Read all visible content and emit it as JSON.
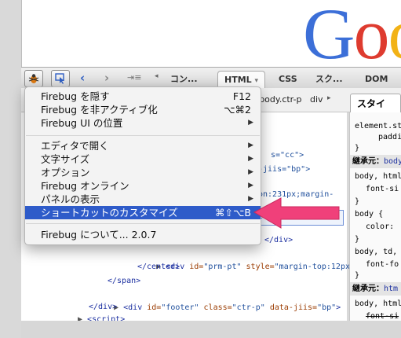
{
  "page": {
    "logo_text": "Goo"
  },
  "toolbar": {
    "tabs": [
      "コン...",
      "HTML",
      "CSS",
      "スク...",
      "DOM"
    ],
    "active_tab_arrow": "▾"
  },
  "pathbar": {
    "crumb1": "n#body.ctr-p",
    "crumb2": "div"
  },
  "side": {
    "tab_label": "スタイル",
    "rules": [
      "element.sty",
      "padding",
      "}",
      "継承元：",
      "body",
      "body, html",
      "font-si",
      "}",
      "body {",
      "color:",
      "}",
      "body, td, a",
      "font-fo",
      "}",
      "継承元：",
      "htm",
      "body, html",
      "font-si"
    ]
  },
  "menu": {
    "items": [
      {
        "label": "Firebug を隠す",
        "shortcut": "F12"
      },
      {
        "label": "Firebug を非アクティブ化",
        "shortcut": "⌥⌘2"
      },
      {
        "label": "Firebug UI の位置",
        "arrow": "▶"
      },
      {
        "label": "エディタで開く",
        "arrow": "▶"
      },
      {
        "label": "文字サイズ",
        "arrow": "▶"
      },
      {
        "label": "オプション",
        "arrow": "▶"
      },
      {
        "label": "Firebug オンライン",
        "arrow": "▶"
      },
      {
        "label": "パネルの表示",
        "arrow": "▶"
      },
      {
        "label": "ショートカットのカスタマイズ",
        "shortcut": "⌘⇧⌥B"
      },
      {
        "label": "Firebug について... 2.0.7"
      }
    ]
  },
  "code": {
    "frag1": "s=\"cc\">",
    "frag2": "-jiis=\"bp\">",
    "frag3": "on:231px;margin-",
    "frag4": "e\">",
    "close_div1": "</div>",
    "prm": {
      "open": "<div",
      "attr1": "id=",
      "val1": "\"prm-pt\"",
      "attr2": "style=",
      "val2": "\"margin-top:12px\"",
      "end": ">"
    },
    "close_center": "</center>",
    "close_span": "</span>",
    "footer": {
      "open": "<div",
      "attr1": "id=",
      "val1": "\"footer\"",
      "attr2": "class=",
      "val2": "\"ctr-p\"",
      "attr3": "data-jiis=",
      "val3": "\"bp\"",
      "end": ">"
    },
    "close_div2": "</div>",
    "script": "<script>"
  },
  "colors": {
    "arrow": "#f0407a",
    "highlight": "#2e5bc9",
    "logo_blue": "#3c6fd8",
    "logo_red": "#de3b2f",
    "logo_yellow": "#f2b216"
  }
}
